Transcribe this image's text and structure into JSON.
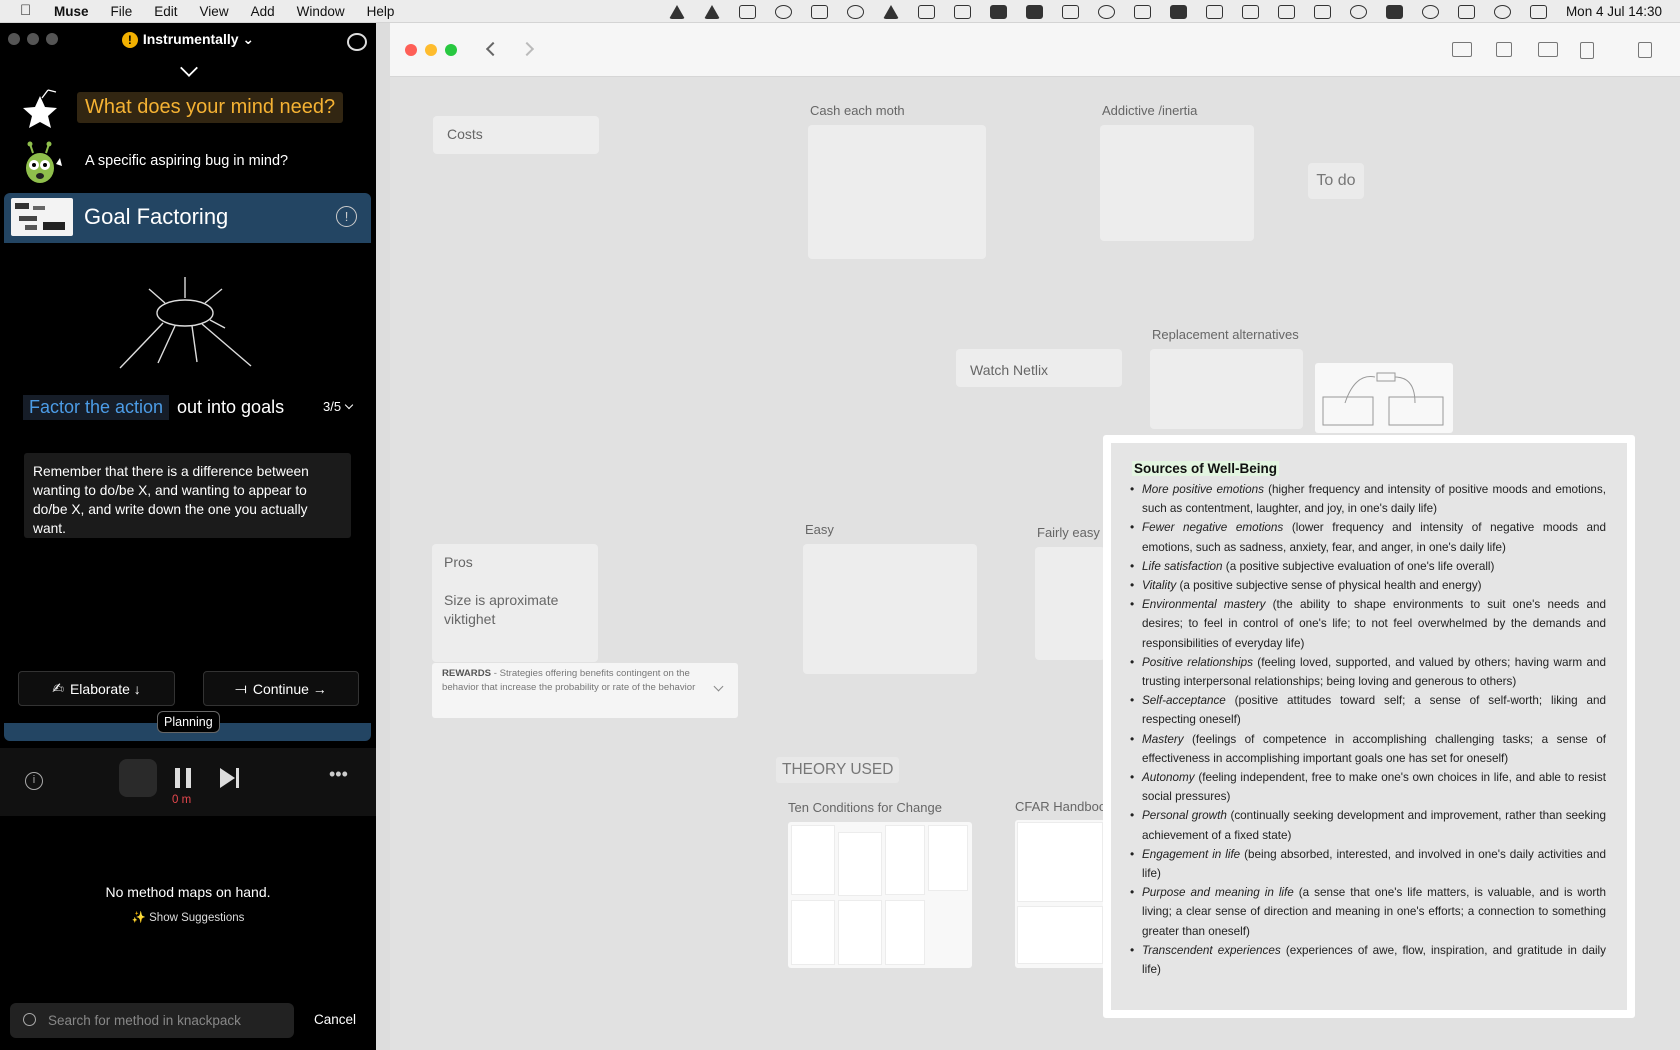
{
  "menubar": {
    "app": "Muse",
    "menus": [
      "File",
      "Edit",
      "View",
      "Add",
      "Window",
      "Help"
    ],
    "clock": "Mon 4 Jul  14:30"
  },
  "left": {
    "header": "Instrumentally",
    "mind_prompt": "What does your mind need?",
    "bug_prompt": "A specific aspiring bug in mind?",
    "method_title": "Goal Factoring",
    "step_highlight": "Factor the action",
    "step_rest": "out into goals",
    "step_count": "3/5",
    "note": "Remember that there is a difference between wanting to do/be X, and wanting to appear to do/be X, and write down the one you actually want.",
    "elaborate": "Elaborate ↓",
    "continue": "Continue →",
    "planning": "Planning",
    "timer": "0 m",
    "empty": "No method maps on hand.",
    "suggestions": "✨ Show Suggestions",
    "search_placeholder": "Search for method in knackpack",
    "cancel": "Cancel"
  },
  "board": {
    "costs": "Costs",
    "cash_title": "Cash each moth",
    "addictive_title": "Addictive /inertia",
    "todo": "To do",
    "replacement_title": "Replacement alternatives",
    "watch_netflix": "Watch Netlix",
    "easy_title": "Easy",
    "fairly_easy_title": "Fairly easy",
    "pros": "Pros",
    "size_note": "Size is aproximate viktighet",
    "rewards_label": "REWARDS",
    "rewards_text": " - Strategies offering benefits contingent on the behavior that increase the probability or rate of the behavior",
    "theory": "THEORY USED",
    "ten_conditions": "Ten Conditions for Change",
    "cfar": "CFAR Handboo"
  },
  "sources": {
    "title": "Sources of Well-Being",
    "items": [
      {
        "term": "More positive emotions",
        "text": " (higher frequency and intensity of positive moods and emotions, such as contentment, laughter, and joy, in one's daily life)"
      },
      {
        "term": "Fewer negative emotions",
        "text": " (lower frequency and intensity of negative moods and emotions, such as sadness, anxiety, fear, and anger, in one's daily life)"
      },
      {
        "term": "Life satisfaction",
        "text": " (a positive subjective evaluation of one's life overall)"
      },
      {
        "term": "Vitality",
        "text": " (a positive subjective sense of physical health and energy)"
      },
      {
        "term": "Environmental mastery",
        "text": " (the ability to shape environments to suit one's needs and desires; to feel in control of one's life; to not feel overwhelmed by the demands and responsibilities of everyday life)"
      },
      {
        "term": "Positive relationships",
        "text": " (feeling loved, supported, and valued by others; having warm and trusting interpersonal relationships; being loving and generous to others)"
      },
      {
        "term": "Self-acceptance",
        "text": " (positive attitudes toward self; a sense of self-worth; liking and respecting oneself)"
      },
      {
        "term": "Mastery",
        "text": " (feelings of competence in accomplishing challenging tasks; a sense of effectiveness in accomplishing important goals one has set for oneself)"
      },
      {
        "term": "Autonomy",
        "text": " (feeling independent, free to make one's own choices in life, and able to resist social pressures)"
      },
      {
        "term": "Personal growth",
        "text": " (continually seeking development and improvement, rather than seeking achievement of a fixed state)"
      },
      {
        "term": "Engagement in life",
        "text": " (being absorbed, interested, and involved in one's daily activities and life)"
      },
      {
        "term": "Purpose and meaning in life",
        "text": " (a sense that one's life matters, is valuable, and is worth living; a clear sense of direction and meaning in one's efforts; a connection to something greater than oneself)"
      },
      {
        "term": "Transcendent experiences",
        "text": " (experiences of awe, flow, inspiration, and gratitude in daily life)"
      }
    ]
  },
  "colors": {
    "accent_blue": "#234563",
    "prompt_orange": "#f5b233",
    "step_blue": "#4c9ce6",
    "timer_red": "#e6484e",
    "title_highlight": "#e3f5e0"
  },
  "icons": [
    "apple-icon",
    "warning-icon",
    "user-icon",
    "chevron-down-icon",
    "star-icon",
    "bug-mascot-icon",
    "info-icon",
    "pause-icon",
    "skip-next-icon",
    "cards-icon",
    "more-icon",
    "search-icon",
    "back-icon",
    "forward-icon",
    "share-icon"
  ]
}
